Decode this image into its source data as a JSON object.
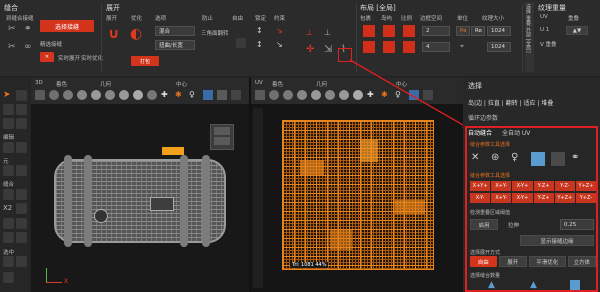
{
  "ribbon": {
    "section1": {
      "title": "缝合",
      "items": [
        "到缝合接缝",
        "精选接缝",
        "实时展开",
        "实时优化"
      ],
      "pack_btn": "选择接缝"
    },
    "section2": {
      "title": "展开",
      "items": [
        "展开",
        "优化",
        "选项",
        "防止",
        "自由",
        "锁定",
        "约束"
      ],
      "dropdown1": "混合",
      "dropdown2": "扭曲/长宽",
      "dropdown3": "三角面翻转",
      "pack_label": "打包"
    },
    "section3": {
      "title": "布局 [全局]",
      "items": [
        "包裹",
        "岛屿",
        "比例",
        "边框空间",
        "单位",
        "纹理大小"
      ],
      "field1": "2",
      "field2": "4",
      "field3": "Pa",
      "field4": "Re",
      "field5": "1024",
      "field6": "1024"
    },
    "section4": {
      "title": "纹理重量",
      "items": [
        "UV",
        "重叠",
        "U 1",
        "V 重叠"
      ],
      "vertical_tab": "选择 重叠 外部 [全局]"
    }
  },
  "left_toolbar": {
    "labels": [
      "编辑",
      "元",
      "画",
      "全",
      "缝合",
      "X2",
      "选中"
    ]
  },
  "viewport3d": {
    "toolbar": [
      "3D",
      "着色",
      "几何"
    ],
    "axis_x": "X",
    "axis_y": "Y",
    "grid_label": "中心"
  },
  "viewportuv": {
    "toolbar": [
      "UV",
      "着色",
      "几何"
    ],
    "grid_label": "中心",
    "status_line": "Tri: 1081 44%"
  },
  "right_panel": {
    "select_title": "选择",
    "modes": "岛|边 | 拉直 | 翻转 | 适应 | 堆叠",
    "loop_label": "循环边参数",
    "tab1": "自动缝合",
    "tab2": "全自动 UV",
    "sub_title": "缝合参数工具选择",
    "seg_label": "缝合参数工具选择",
    "axis_buttons_row1": [
      "X+Y+",
      "X+Y-",
      "X-Y+",
      "Y-Z+",
      "Y-Z-",
      "Y+Z+"
    ],
    "axis_buttons_row2": [
      "X-Y-",
      "X+Y-",
      "X-Y+",
      "Y-Z+",
      "Y+Z+",
      "Y+Z-"
    ],
    "edge_label": "检测重叠区域阈值",
    "apply_btn": "启用",
    "tol_label": "拉伸",
    "tol_value": "0.25",
    "display_btn": "显示接缝边缘",
    "process_label": "选择展开方式",
    "mode_btns": [
      "自由",
      "展开",
      "平滑优化",
      "立方体"
    ],
    "bottom_label": "选择缝合数量"
  },
  "colors": {
    "accent": "#e8731e",
    "red_btn": "#d5341c",
    "highlight_box": "#e02020"
  }
}
